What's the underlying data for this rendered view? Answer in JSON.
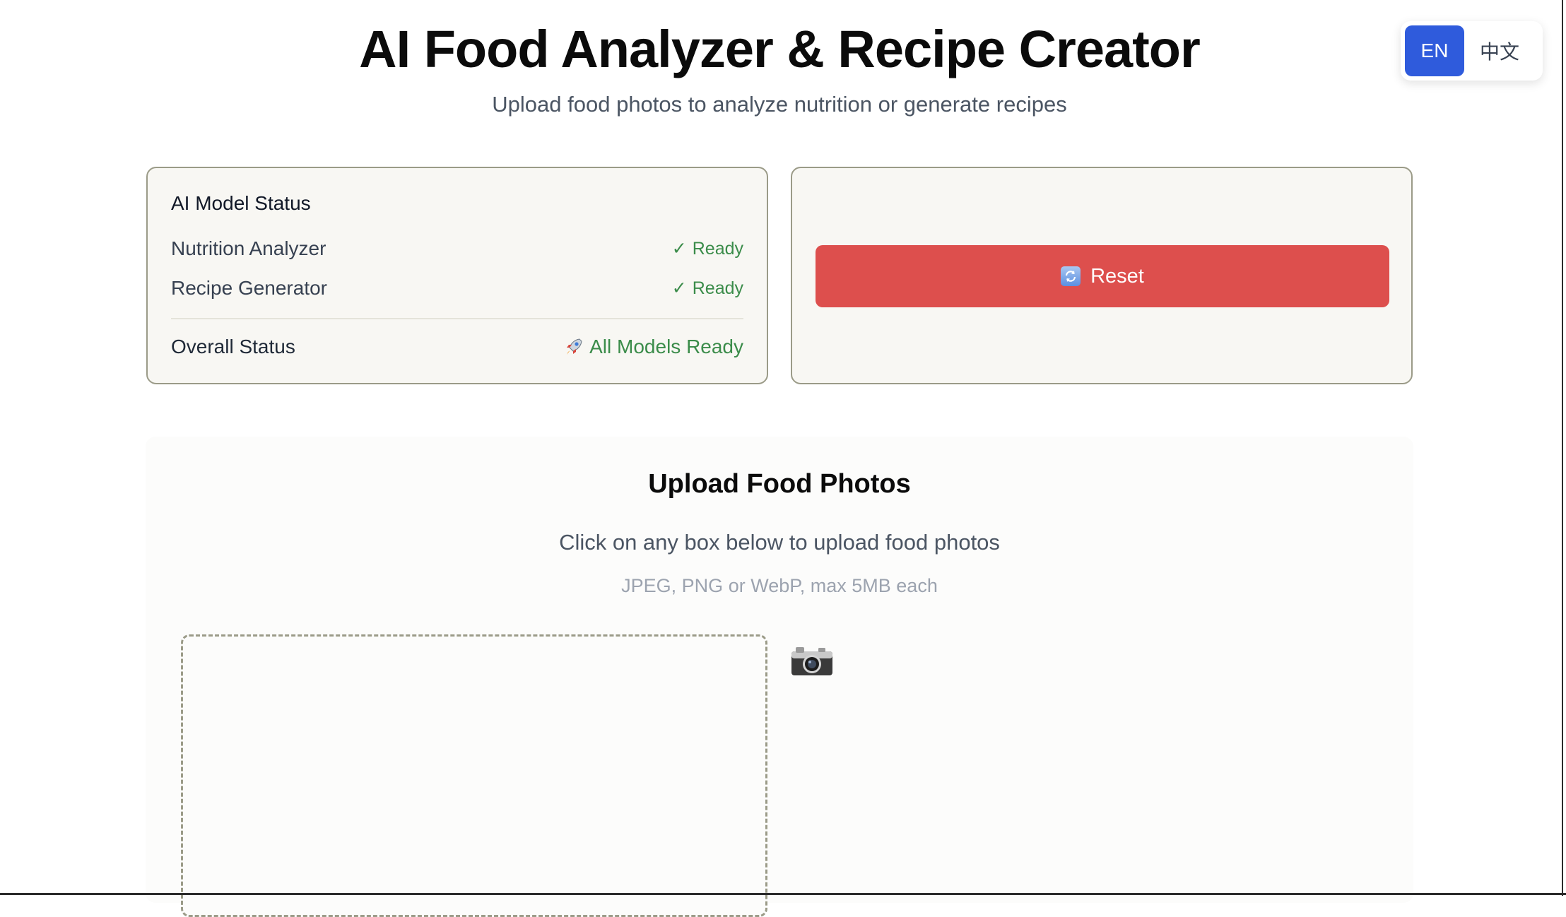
{
  "header": {
    "title": "AI Food Analyzer & Recipe Creator",
    "subtitle": "Upload food photos to analyze nutrition or generate recipes"
  },
  "language": {
    "options": [
      "EN",
      "中文"
    ],
    "selected": "EN"
  },
  "model_status": {
    "heading": "AI Model Status",
    "items": [
      {
        "label": "Nutrition Analyzer",
        "status": "Ready"
      },
      {
        "label": "Recipe Generator",
        "status": "Ready"
      }
    ],
    "check_glyph": "✓",
    "overall_label": "Overall Status",
    "overall_value": "All Models Ready",
    "overall_icon": "rocket-icon"
  },
  "actions": {
    "reset_label": "Reset",
    "reset_icon": "refresh-icon"
  },
  "upload": {
    "title": "Upload Food Photos",
    "instruction": "Click on any box below to upload food photos",
    "formats": "JPEG, PNG or WebP, max 5MB each",
    "icon": "camera-icon"
  },
  "colors": {
    "accent_blue": "#2f5bdc",
    "status_green": "#3b8c4a",
    "reset_red": "#dd4f4d",
    "card_border": "#9b9b88"
  }
}
